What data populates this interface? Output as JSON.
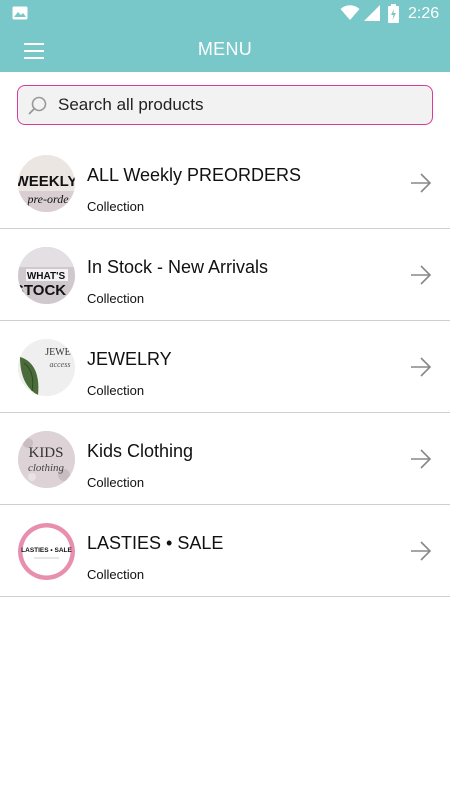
{
  "status_bar": {
    "time": "2:26",
    "icons": [
      "image-icon",
      "wifi-icon",
      "signal-icon",
      "battery-icon"
    ]
  },
  "app_bar": {
    "title": "MENU",
    "menu_icon": "hamburger-menu-icon"
  },
  "search": {
    "placeholder": "Search all products",
    "value": "",
    "border_color": "#d63c9b"
  },
  "colors": {
    "accent": "#78c7c9"
  },
  "collections": [
    {
      "title": "ALL Weekly PREORDERS",
      "subtitle": "Collection",
      "thumb_text": [
        "WEEKLY",
        "pre-orde"
      ]
    },
    {
      "title": "In Stock - New Arrivals",
      "subtitle": "Collection",
      "thumb_text": [
        "WHAT'S",
        "STOCK"
      ]
    },
    {
      "title": "JEWELRY",
      "subtitle": "Collection",
      "thumb_text": [
        "JEWE",
        "access"
      ]
    },
    {
      "title": "Kids Clothing",
      "subtitle": "Collection",
      "thumb_text": [
        "KIDS",
        "clothing"
      ]
    },
    {
      "title": "LASTIES • SALE",
      "subtitle": "Collection",
      "thumb_text": [
        "LASTIES • SALE"
      ]
    }
  ]
}
